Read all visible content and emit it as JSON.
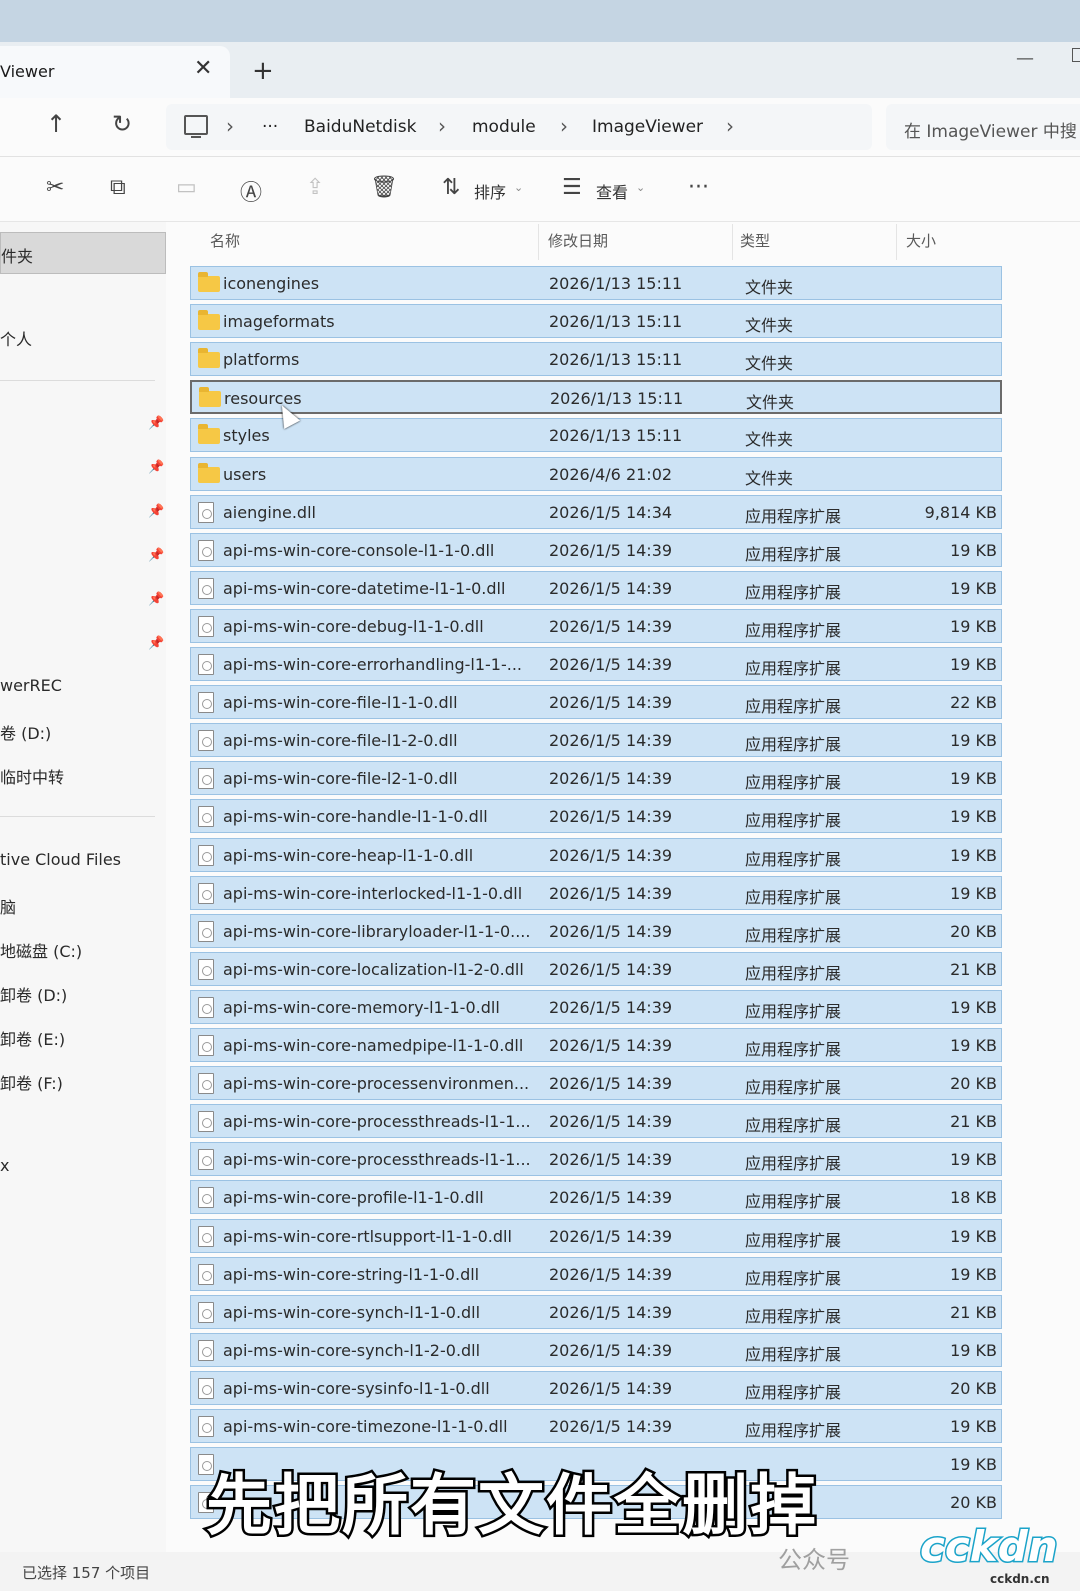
{
  "tab": {
    "title": "Viewer",
    "close": "✕",
    "new_tab": "+"
  },
  "window": {
    "minimize": "—"
  },
  "nav": {
    "back": "↑",
    "refresh": "↻",
    "more": "···",
    "breadcrumbs": [
      "BaiduNetdisk",
      "module",
      "ImageViewer"
    ],
    "chevron": "›",
    "search_placeholder": "在 ImageViewer 中搜"
  },
  "commands": {
    "cut": "✂",
    "copy": "⧉",
    "paste": "▭",
    "rename": "Ⓐ",
    "share": "⇪",
    "delete": "🗑",
    "sort_icon": "⇅",
    "sort_label": "排序",
    "view_icon": "☰",
    "view_label": "查看",
    "more": "···",
    "dropdown": "⌄"
  },
  "sidebar": {
    "selected": "件夹",
    "items": [
      "个人",
      "werREC",
      "卷 (D:)",
      "临时中转",
      "tive Cloud Files",
      "脑",
      "地磁盘 (C:)",
      "卸卷 (D:)",
      "卸卷 (E:)",
      "卸卷 (F:)",
      "x"
    ]
  },
  "columns": {
    "name": "名称",
    "date": "修改日期",
    "type": "类型",
    "size": "大小"
  },
  "files": [
    {
      "name": "iconengines",
      "date": "2026/1/13 15:11",
      "type": "文件夹",
      "size": "",
      "kind": "folder"
    },
    {
      "name": "imageformats",
      "date": "2026/1/13 15:11",
      "type": "文件夹",
      "size": "",
      "kind": "folder"
    },
    {
      "name": "platforms",
      "date": "2026/1/13 15:11",
      "type": "文件夹",
      "size": "",
      "kind": "folder"
    },
    {
      "name": "resources",
      "date": "2026/1/13 15:11",
      "type": "文件夹",
      "size": "",
      "kind": "folder",
      "focused": true
    },
    {
      "name": "styles",
      "date": "2026/1/13 15:11",
      "type": "文件夹",
      "size": "",
      "kind": "folder"
    },
    {
      "name": "users",
      "date": "2026/4/6 21:02",
      "type": "文件夹",
      "size": "",
      "kind": "folder"
    },
    {
      "name": "aiengine.dll",
      "date": "2026/1/5 14:34",
      "type": "应用程序扩展",
      "size": "9,814 KB",
      "kind": "file"
    },
    {
      "name": "api-ms-win-core-console-l1-1-0.dll",
      "date": "2026/1/5 14:39",
      "type": "应用程序扩展",
      "size": "19 KB",
      "kind": "file"
    },
    {
      "name": "api-ms-win-core-datetime-l1-1-0.dll",
      "date": "2026/1/5 14:39",
      "type": "应用程序扩展",
      "size": "19 KB",
      "kind": "file"
    },
    {
      "name": "api-ms-win-core-debug-l1-1-0.dll",
      "date": "2026/1/5 14:39",
      "type": "应用程序扩展",
      "size": "19 KB",
      "kind": "file"
    },
    {
      "name": "api-ms-win-core-errorhandling-l1-1-...",
      "date": "2026/1/5 14:39",
      "type": "应用程序扩展",
      "size": "19 KB",
      "kind": "file"
    },
    {
      "name": "api-ms-win-core-file-l1-1-0.dll",
      "date": "2026/1/5 14:39",
      "type": "应用程序扩展",
      "size": "22 KB",
      "kind": "file"
    },
    {
      "name": "api-ms-win-core-file-l1-2-0.dll",
      "date": "2026/1/5 14:39",
      "type": "应用程序扩展",
      "size": "19 KB",
      "kind": "file"
    },
    {
      "name": "api-ms-win-core-file-l2-1-0.dll",
      "date": "2026/1/5 14:39",
      "type": "应用程序扩展",
      "size": "19 KB",
      "kind": "file"
    },
    {
      "name": "api-ms-win-core-handle-l1-1-0.dll",
      "date": "2026/1/5 14:39",
      "type": "应用程序扩展",
      "size": "19 KB",
      "kind": "file"
    },
    {
      "name": "api-ms-win-core-heap-l1-1-0.dll",
      "date": "2026/1/5 14:39",
      "type": "应用程序扩展",
      "size": "19 KB",
      "kind": "file"
    },
    {
      "name": "api-ms-win-core-interlocked-l1-1-0.dll",
      "date": "2026/1/5 14:39",
      "type": "应用程序扩展",
      "size": "19 KB",
      "kind": "file"
    },
    {
      "name": "api-ms-win-core-libraryloader-l1-1-0....",
      "date": "2026/1/5 14:39",
      "type": "应用程序扩展",
      "size": "20 KB",
      "kind": "file"
    },
    {
      "name": "api-ms-win-core-localization-l1-2-0.dll",
      "date": "2026/1/5 14:39",
      "type": "应用程序扩展",
      "size": "21 KB",
      "kind": "file"
    },
    {
      "name": "api-ms-win-core-memory-l1-1-0.dll",
      "date": "2026/1/5 14:39",
      "type": "应用程序扩展",
      "size": "19 KB",
      "kind": "file"
    },
    {
      "name": "api-ms-win-core-namedpipe-l1-1-0.dll",
      "date": "2026/1/5 14:39",
      "type": "应用程序扩展",
      "size": "19 KB",
      "kind": "file"
    },
    {
      "name": "api-ms-win-core-processenvironmen...",
      "date": "2026/1/5 14:39",
      "type": "应用程序扩展",
      "size": "20 KB",
      "kind": "file"
    },
    {
      "name": "api-ms-win-core-processthreads-l1-1...",
      "date": "2026/1/5 14:39",
      "type": "应用程序扩展",
      "size": "21 KB",
      "kind": "file"
    },
    {
      "name": "api-ms-win-core-processthreads-l1-1...",
      "date": "2026/1/5 14:39",
      "type": "应用程序扩展",
      "size": "19 KB",
      "kind": "file"
    },
    {
      "name": "api-ms-win-core-profile-l1-1-0.dll",
      "date": "2026/1/5 14:39",
      "type": "应用程序扩展",
      "size": "18 KB",
      "kind": "file"
    },
    {
      "name": "api-ms-win-core-rtlsupport-l1-1-0.dll",
      "date": "2026/1/5 14:39",
      "type": "应用程序扩展",
      "size": "19 KB",
      "kind": "file"
    },
    {
      "name": "api-ms-win-core-string-l1-1-0.dll",
      "date": "2026/1/5 14:39",
      "type": "应用程序扩展",
      "size": "19 KB",
      "kind": "file"
    },
    {
      "name": "api-ms-win-core-synch-l1-1-0.dll",
      "date": "2026/1/5 14:39",
      "type": "应用程序扩展",
      "size": "21 KB",
      "kind": "file"
    },
    {
      "name": "api-ms-win-core-synch-l1-2-0.dll",
      "date": "2026/1/5 14:39",
      "type": "应用程序扩展",
      "size": "19 KB",
      "kind": "file"
    },
    {
      "name": "api-ms-win-core-sysinfo-l1-1-0.dll",
      "date": "2026/1/5 14:39",
      "type": "应用程序扩展",
      "size": "20 KB",
      "kind": "file"
    },
    {
      "name": "api-ms-win-core-timezone-l1-1-0.dll",
      "date": "2026/1/5 14:39",
      "type": "应用程序扩展",
      "size": "19 KB",
      "kind": "file"
    },
    {
      "name": "",
      "date": "",
      "type": "",
      "size": "19 KB",
      "kind": "file"
    },
    {
      "name": "",
      "date": "",
      "type": "",
      "size": "20 KB",
      "kind": "file"
    }
  ],
  "status": {
    "text": "已选择 157 个项目"
  },
  "overlay": {
    "caption": "先把所有文件全删掉",
    "watermark": "公众号",
    "logo": "cckdn",
    "logo_small": "cckdn.cn"
  },
  "colors": {
    "selection": "#cde3f5",
    "selection_border": "#9bc2e3",
    "folder": "#f6c845"
  }
}
